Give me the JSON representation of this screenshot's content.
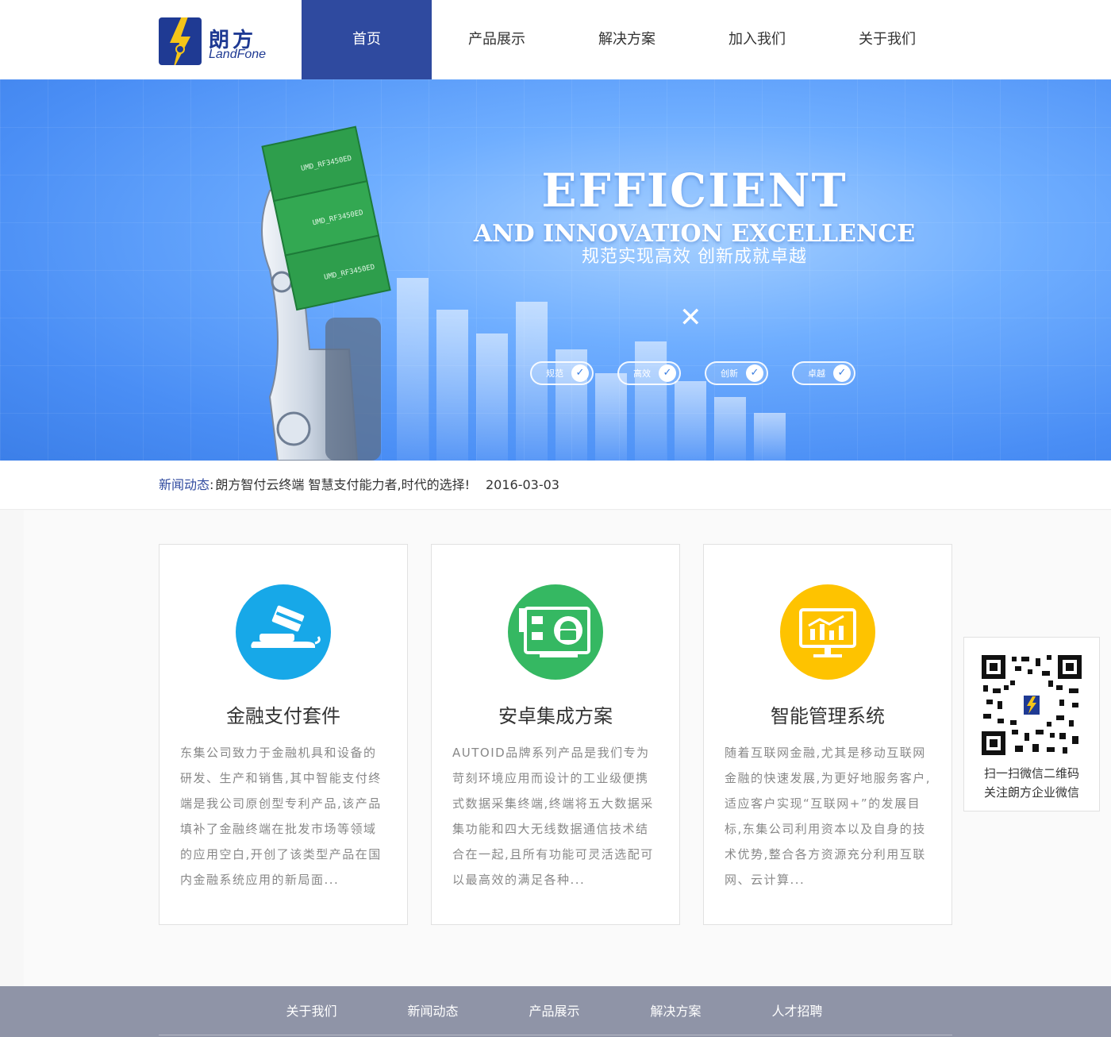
{
  "brand": {
    "name_cn": "朗方",
    "name_en": "LandFone"
  },
  "nav": {
    "items": [
      "首页",
      "产品展示",
      "解决方案",
      "加入我们",
      "关于我们"
    ],
    "active": 0
  },
  "banner": {
    "headline_1": "EFFICIENT",
    "headline_2": "AND INNOVATION EXCELLENCE",
    "subheadline": "规范实现高效 创新成就卓越",
    "pills": [
      "规范",
      "高效",
      "创新",
      "卓越"
    ],
    "chip_label": "UMD_RF3450ED"
  },
  "news": {
    "label": "新闻动态",
    "separator": ":",
    "title": "朗方智付云终端 智慧支付能力者,时代的选择!",
    "date": "2016-03-03"
  },
  "cards": [
    {
      "title": "金融支付套件",
      "icon": "card-payment-icon",
      "color": "#17a8e8",
      "desc": "东集公司致力于金融机具和设备的研发、生产和销售,其中智能支付终端是我公司原创型专利产品,该产品填补了金融终端在批发市场等领域的应用空白,开创了该类型产品在国内金融系统应用的新局面..."
    },
    {
      "title": "安卓集成方案",
      "icon": "android-board-icon",
      "color": "#35b862",
      "desc": "AUTOID品牌系列产品是我们专为苛刻环境应用而设计的工业级便携式数据采集终端,终端将五大数据采集功能和四大无线数据通信技术结合在一起,且所有功能可灵活选配可以最高效的满足各种..."
    },
    {
      "title": "智能管理系统",
      "icon": "monitor-chart-icon",
      "color": "#fec300",
      "desc": "随着互联网金融,尤其是移动互联网金融的快速发展,为更好地服务客户,适应客户实现“互联网+”的发展目标,东集公司利用资本以及自身的技术优势,整合各方资源充分利用互联网、云计算..."
    }
  ],
  "qr": {
    "line1": "扫一扫微信二维码",
    "line2": "关注朗方企业微信"
  },
  "footer": {
    "items": [
      "关于我们",
      "新闻动态",
      "产品展示",
      "解决方案",
      "人才招聘"
    ]
  },
  "colors": {
    "primary": "#2f4a9f",
    "banner": "#4a8ef5",
    "footer": "#8f94a7"
  }
}
